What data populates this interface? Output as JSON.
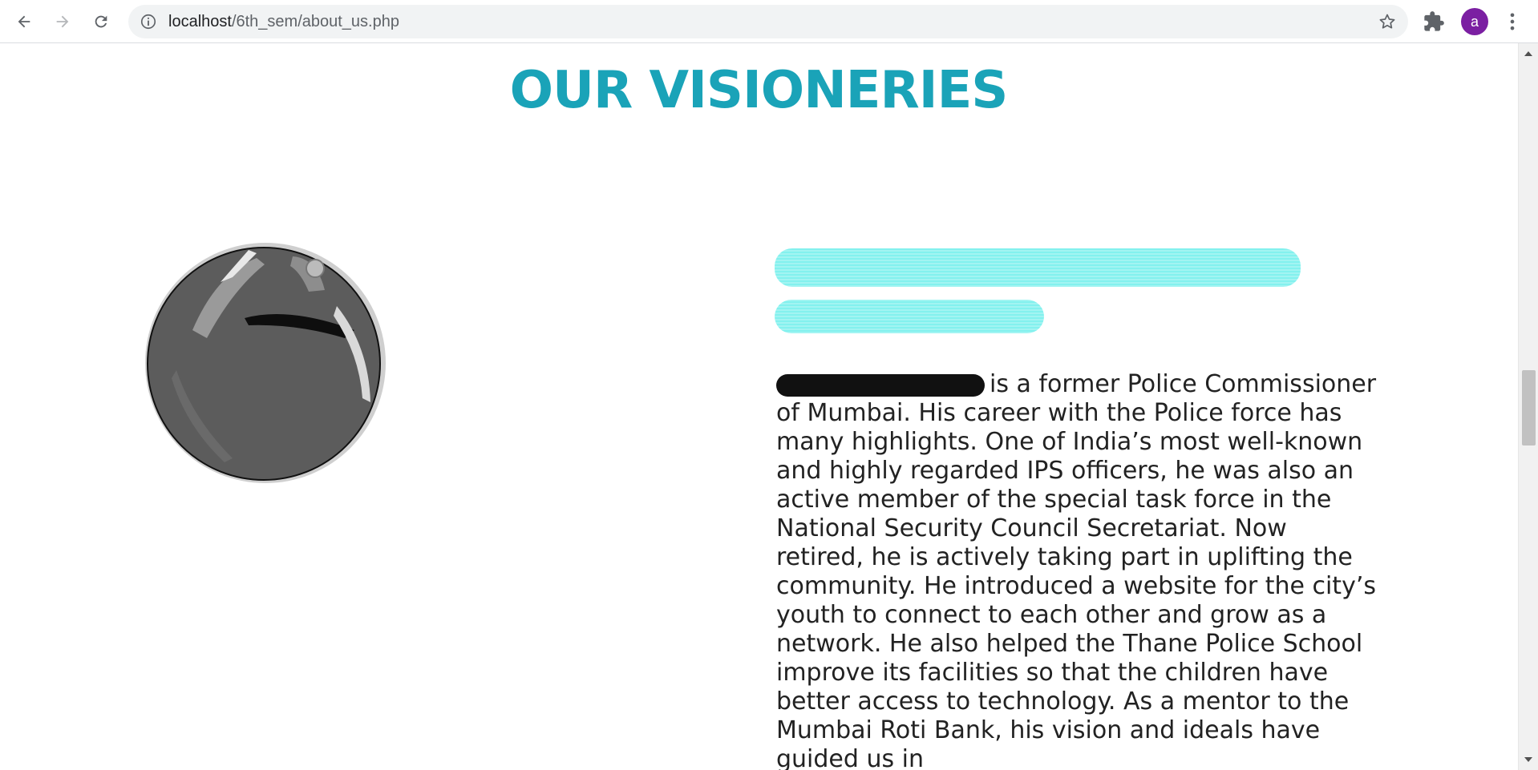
{
  "browser": {
    "url_host": "localhost",
    "url_path": "/6th_sem/about_us.php",
    "profile_initial": "a"
  },
  "page": {
    "heading": "OUR VISIONERIES",
    "profile": {
      "name_line_1": "",
      "name_line_2": "",
      "bio": "is a former Police Commissioner of Mumbai. His career with the Police force has many highlights. One of India’s most well-known and highly regarded IPS officers, he was also an active member of the special task force in the National Security Council Secretariat. Now retired, he is actively taking part in uplifting the community. He introduced a website for the city’s youth to connect to each other and grow as a network. He also helped the Thane Police School improve its facilities so that the children have better access to technology. As a mentor to the Mumbai Roti Bank, his vision and ideals have guided us in"
    }
  },
  "colors": {
    "accent": "#1aa3b8",
    "redaction_cyan": "#7ff1ee",
    "avatar": "#7b1fa2"
  },
  "icons": {
    "back": "arrow-left-icon",
    "forward": "arrow-right-icon",
    "reload": "reload-icon",
    "site_info": "info-icon",
    "bookmark": "star-icon",
    "extensions": "puzzle-icon",
    "menu": "kebab-menu-icon"
  }
}
